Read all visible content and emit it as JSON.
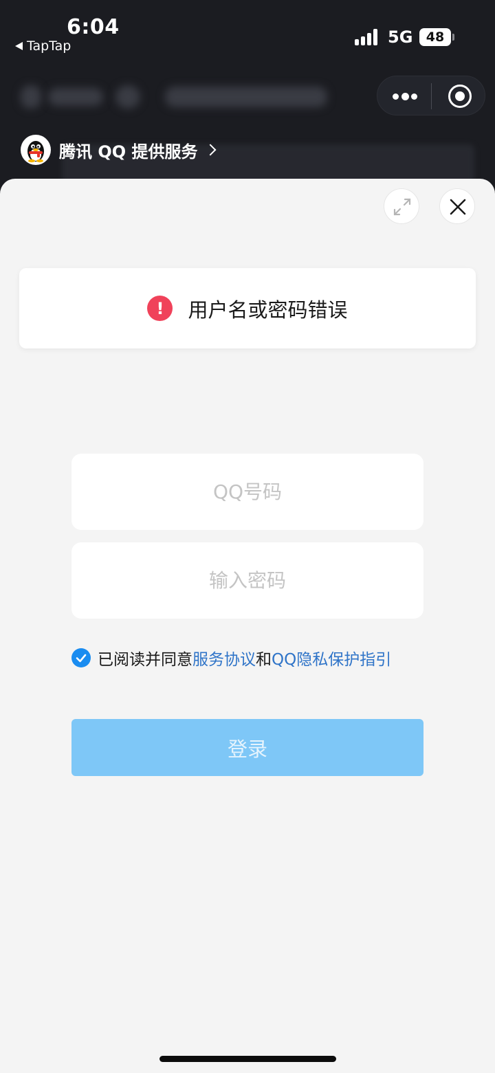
{
  "status_bar": {
    "time": "6:04",
    "back_app": "TapTap",
    "network": "5G",
    "battery": "48"
  },
  "provider": {
    "label": "腾讯 QQ 提供服务"
  },
  "error": {
    "icon": "!",
    "message": "用户名或密码错误"
  },
  "form": {
    "qq_placeholder": "QQ号码",
    "password_placeholder": "输入密码",
    "agreement_prefix": "已阅读并同意",
    "service_agreement": "服务协议",
    "and": "和",
    "privacy_guide": "QQ隐私保护指引",
    "agreed": true,
    "login_label": "登录"
  },
  "colors": {
    "error": "#f0425a",
    "link": "#2f74c8",
    "checkbox": "#1a8cf0",
    "login_disabled": "#7ec7f7",
    "sheet_bg": "#f4f4f4",
    "top_bg": "#1b1c21"
  },
  "icons": {
    "expand": "expand-icon",
    "close": "close-icon",
    "more": "more-dots-icon",
    "target": "target-icon",
    "check": "checkmark-icon",
    "chevron": "chevron-right-icon"
  }
}
